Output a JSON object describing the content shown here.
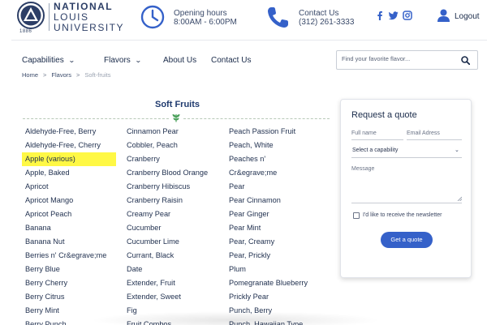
{
  "header": {
    "logo": {
      "line1": "NATIONAL",
      "line2": "LOUIS",
      "line3": "UNIVERSITY",
      "year": "1886"
    },
    "hours": {
      "label": "Opening hours",
      "value": "8:00AM - 6:00PM"
    },
    "contact": {
      "label": "Contact Us",
      "value": "(312) 261-3333"
    },
    "social": [
      "facebook-icon",
      "twitter-icon",
      "instagram-icon"
    ],
    "logout_label": "Logout"
  },
  "nav": {
    "items": [
      {
        "label": "Capabilities",
        "dropdown": true
      },
      {
        "label": "Flavors",
        "dropdown": true
      },
      {
        "label": "About Us",
        "dropdown": false
      },
      {
        "label": "Contact Us",
        "dropdown": false
      }
    ],
    "search_placeholder": "Find your favorite flavor..."
  },
  "breadcrumb": {
    "items": [
      "Home",
      "Flavors"
    ],
    "separator": ">",
    "current": "Soft-fruits"
  },
  "section": {
    "title": "Soft Fruits"
  },
  "flavors": {
    "columns": [
      [
        "Aldehyde-Free, Berry",
        "Aldehyde-Free, Cherry",
        "Apple (various)",
        "Apple, Baked",
        "Apricot",
        "Apricot Mango",
        "Apricot Peach",
        "Banana",
        "Banana Nut",
        "Berries n' Cr&egrave;me",
        "Berry Blue",
        "Berry Cherry",
        "Berry Citrus",
        "Berry Mint",
        "Berry Punch"
      ],
      [
        "Cinnamon Pear",
        "Cobbler, Peach",
        "Cranberry",
        "Cranberry Blood Orange",
        "Cranberry Hibiscus",
        "Cranberry Raisin",
        "Creamy Pear",
        "Cucumber",
        "Cucumber Lime",
        "Currant, Black",
        "Date",
        "Extender, Fruit",
        "Extender, Sweet",
        "Fig",
        "Fruit Combos"
      ],
      [
        "Peach Passion Fruit",
        "Peach, White",
        "Peaches n'",
        "Cr&egrave;me",
        "Pear",
        "Pear Cinnamon",
        "Pear Ginger",
        "Pear Mint",
        "Pear, Creamy",
        "Pear, Prickly",
        "Plum",
        "Pomegranate Blueberry",
        "Prickly Pear",
        "Punch, Berry",
        "Punch, Hawaiian Type"
      ]
    ],
    "highlighted": "Apple (various)",
    "highlight_color": "#fff845"
  },
  "quote": {
    "title": "Request a quote",
    "full_name_placeholder": "Full name",
    "email_placeholder": "Email Adress",
    "capability_select": "Select a capability",
    "message_placeholder": "Message",
    "newsletter_label": "I'd like to receive the newsletter",
    "newsletter_checked": false,
    "button_label": "Get a quote",
    "button_color": "#3561c9"
  },
  "colors": {
    "brand": "#2c3e66",
    "accent": "#3561c9",
    "text": "#1f2f4e"
  }
}
